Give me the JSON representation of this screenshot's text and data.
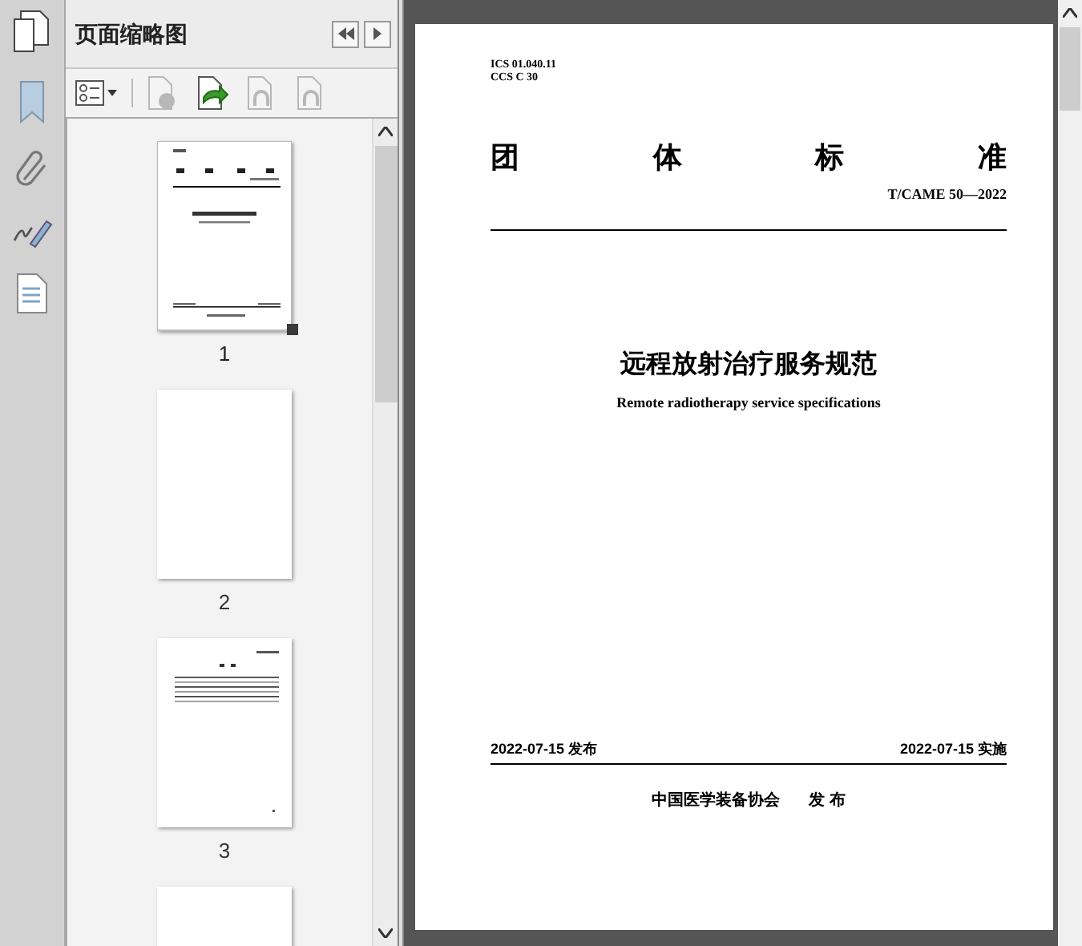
{
  "panel": {
    "title": "页面缩略图"
  },
  "toolbar": [
    {
      "kind": "options",
      "disabled": false
    },
    {
      "kind": "delete",
      "disabled": true
    },
    {
      "kind": "insert",
      "disabled": false
    },
    {
      "kind": "undo",
      "disabled": true
    },
    {
      "kind": "redo",
      "disabled": true
    }
  ],
  "thumbnails": [
    {
      "kind": "cover",
      "page": "1",
      "selected": true
    },
    {
      "kind": "blank",
      "page": "2",
      "selected": false
    },
    {
      "kind": "contents",
      "page": "3",
      "selected": false
    },
    {
      "kind": "cut",
      "selected": false
    }
  ],
  "document": {
    "codes": [
      "ICS 01.040.11",
      "CCS C 30"
    ],
    "category": [
      "团",
      "体",
      "标",
      "准"
    ],
    "number": "T/CAME 50—2022",
    "title": "远程放射治疗服务规范",
    "subtitle": "Remote radiotherapy service specifications",
    "issued": "2022-07-15 发布",
    "effective": "2022-07-15 实施",
    "publisher": "中国医学装备协会",
    "publisher_action": "发 布"
  }
}
